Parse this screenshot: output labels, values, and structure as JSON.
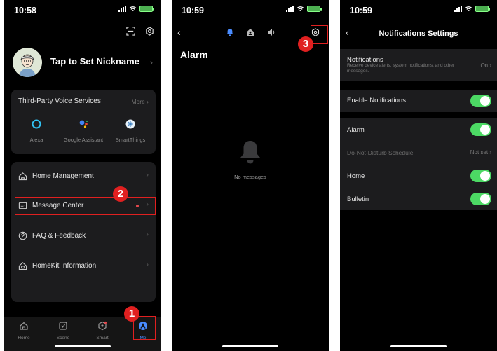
{
  "screen1": {
    "time": "10:58",
    "profile": {
      "nickname": "Tap to Set Nickname"
    },
    "voice_services": {
      "title": "Third-Party Voice Services",
      "more": "More",
      "items": [
        {
          "label": "Alexa",
          "icon": "alexa-icon"
        },
        {
          "label": "Google Assistant",
          "icon": "google-assistant-icon"
        },
        {
          "label": "SmartThings",
          "icon": "smartthings-icon"
        }
      ]
    },
    "menu": [
      {
        "label": "Home Management",
        "icon": "home-icon"
      },
      {
        "label": "Message Center",
        "icon": "message-icon"
      },
      {
        "label": "FAQ & Feedback",
        "icon": "question-icon"
      },
      {
        "label": "HomeKit Information",
        "icon": "homekit-icon"
      }
    ],
    "tabs": [
      {
        "label": "Home",
        "icon": "home-icon"
      },
      {
        "label": "Scene",
        "icon": "scene-icon"
      },
      {
        "label": "Smart",
        "icon": "smart-icon"
      },
      {
        "label": "Me",
        "icon": "me-icon"
      }
    ],
    "annotations": {
      "step1": "1",
      "step2": "2"
    },
    "colors": {
      "accent": "#4a8cff",
      "annotation": "#e02020"
    }
  },
  "screen2": {
    "time": "10:59",
    "title": "Alarm",
    "empty_text": "No messages",
    "annotations": {
      "step3": "3"
    }
  },
  "screen3": {
    "time": "10:59",
    "title": "Notifications Settings",
    "notifications": {
      "label": "Notifications",
      "desc": "Receive device alerts, system notifications, and other messages.",
      "value": "On"
    },
    "enable": {
      "label": "Enable Notifications",
      "on": true
    },
    "alarm": {
      "label": "Alarm",
      "on": true
    },
    "dnd": {
      "label": "Do-Not-Disturb Schedule",
      "value": "Not set"
    },
    "home": {
      "label": "Home",
      "on": true
    },
    "bulletin": {
      "label": "Bulletin",
      "on": true
    },
    "colors": {
      "toggle_on": "#4cd964"
    }
  }
}
